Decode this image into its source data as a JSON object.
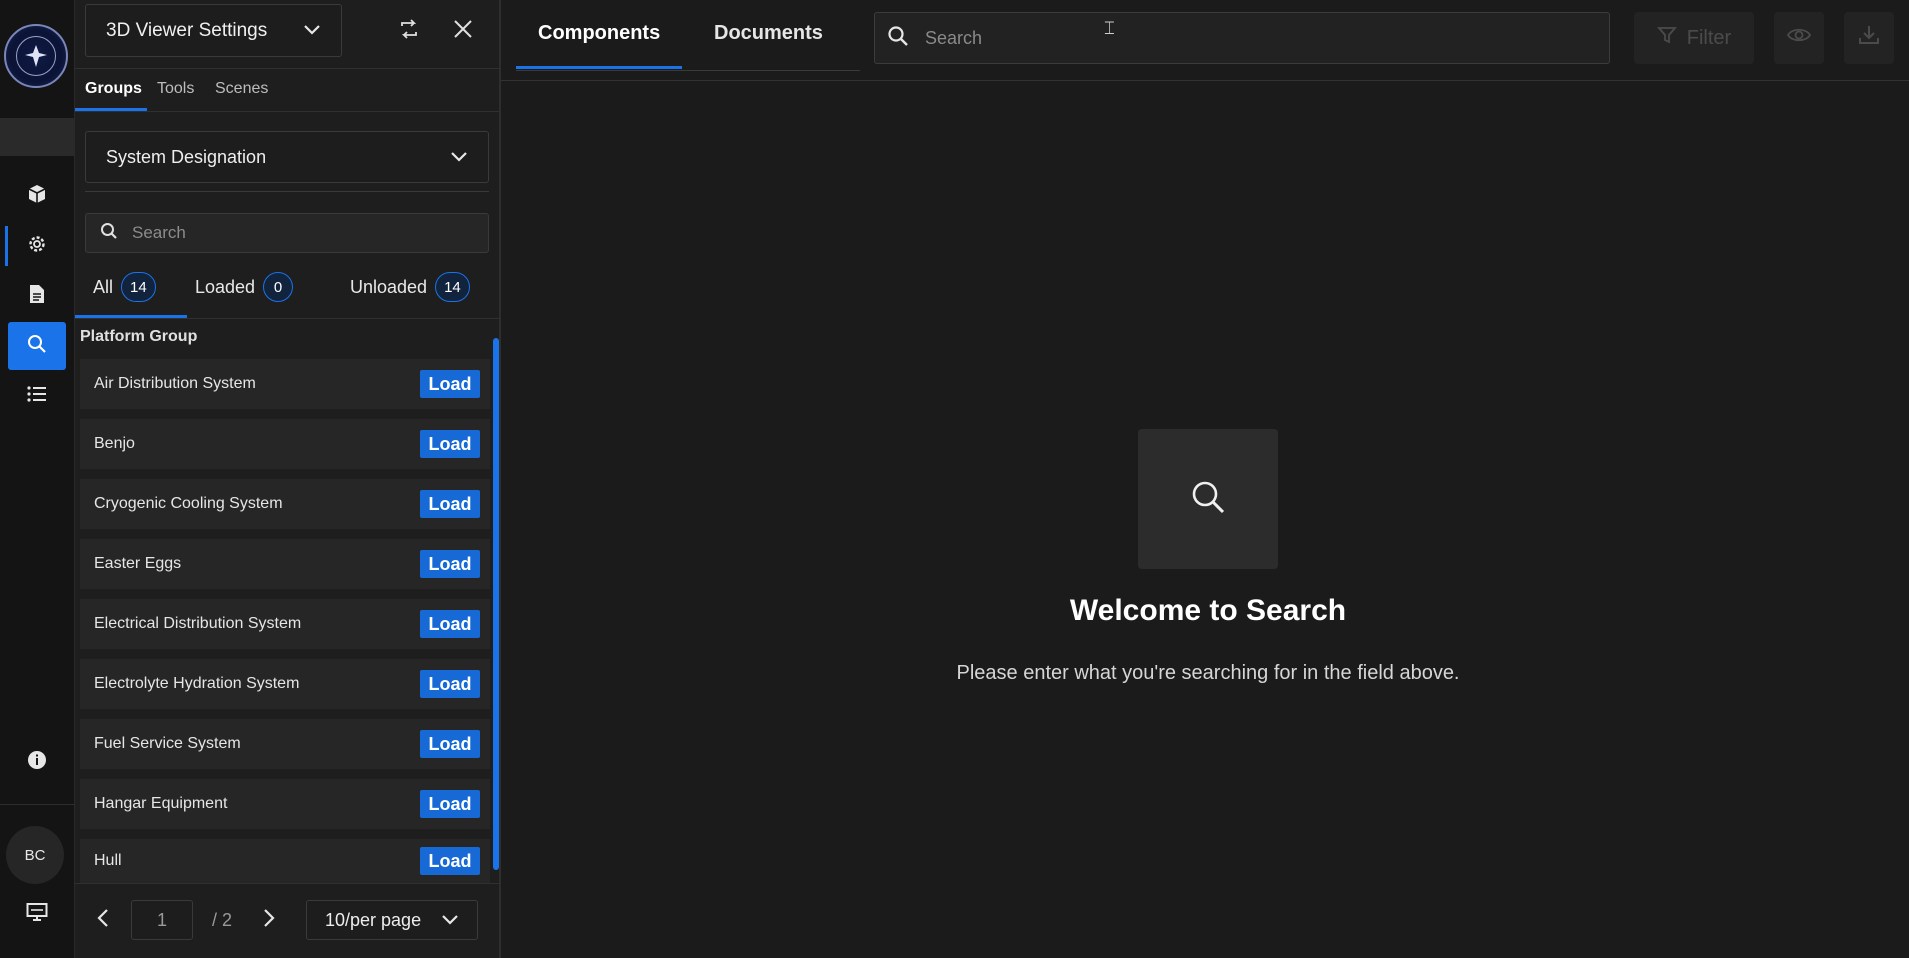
{
  "rail": {
    "user_initials": "BC",
    "items": [
      {
        "icon": "cube-icon"
      },
      {
        "icon": "gear-icon"
      },
      {
        "icon": "document-icon"
      },
      {
        "icon": "search-icon"
      },
      {
        "icon": "list-icon"
      }
    ]
  },
  "panel": {
    "title": "3D Viewer Settings",
    "subtabs": [
      "Groups",
      "Tools",
      "Scenes"
    ],
    "active_subtab": "Groups",
    "select_value": "System Designation",
    "search_placeholder": "Search",
    "filters": [
      {
        "label": "All",
        "count": "14"
      },
      {
        "label": "Loaded",
        "count": "0"
      },
      {
        "label": "Unloaded",
        "count": "14"
      }
    ],
    "group_title": "Platform Group",
    "load_label": "Load",
    "items": [
      {
        "label": "Air Distribution System"
      },
      {
        "label": "Benjo"
      },
      {
        "label": "Cryogenic Cooling System"
      },
      {
        "label": "Easter Eggs"
      },
      {
        "label": "Electrical Distribution System"
      },
      {
        "label": "Electrolyte Hydration System"
      },
      {
        "label": "Fuel Service System"
      },
      {
        "label": "Hangar Equipment"
      },
      {
        "label": "Hull"
      }
    ],
    "pager": {
      "current_page": "1",
      "total_pages": "/ 2",
      "per_page": "10/per page"
    }
  },
  "main": {
    "tabs": [
      "Components",
      "Documents"
    ],
    "active_tab": "Components",
    "search_placeholder": "Search",
    "filter_label": "Filter",
    "empty_title": "Welcome to Search",
    "empty_subtitle": "Please enter what you're searching for in the field above."
  },
  "colors": {
    "accent": "#1a73e8",
    "background": "#1b1b1b",
    "load_button": "#1769d6"
  }
}
